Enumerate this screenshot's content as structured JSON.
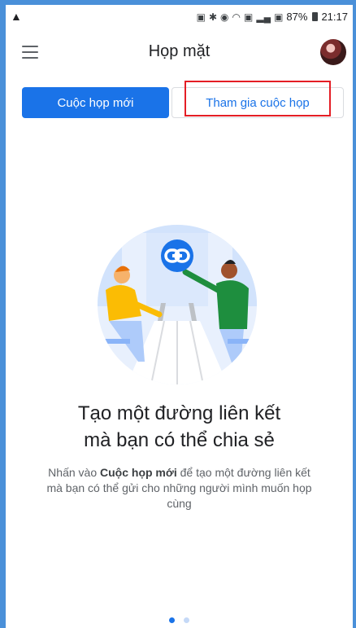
{
  "status_bar": {
    "warning_icon": "warning-icon",
    "battery_text": "87%",
    "time": "21:17"
  },
  "app_bar": {
    "title": "Họp mặt",
    "menu_icon": "hamburger-menu-icon",
    "avatar_icon": "user-avatar"
  },
  "actions": {
    "new_meeting_label": "Cuộc họp mới",
    "join_meeting_label": "Tham gia cuộc họp"
  },
  "onboarding": {
    "headline_line1": "Tạo một đường liên kết",
    "headline_line2": "mà bạn có thể chia sẻ",
    "desc_prefix": "Nhấn vào ",
    "desc_bold": "Cuộc họp mới",
    "desc_suffix": " để tạo một đường liên kết mà bạn có thể gửi cho những người mình muốn họp cùng",
    "link_icon": "link-icon"
  },
  "pager": {
    "current_page": 1,
    "total_pages": 2
  },
  "colors": {
    "primary": "#1a73e8",
    "highlight": "#e41e25",
    "background_frame": "#4a90d9"
  }
}
